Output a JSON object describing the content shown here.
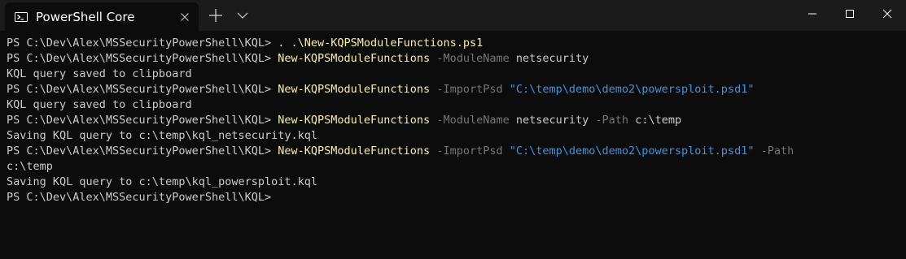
{
  "titlebar": {
    "tab_title": "PowerShell Core",
    "tab_icon": "powershell-icon",
    "new_tab_icon": "plus-icon",
    "dropdown_icon": "chevron-down-icon",
    "minimize_icon": "minimize-icon",
    "maximize_icon": "maximize-icon",
    "close_icon": "close-icon"
  },
  "colors": {
    "background": "#0c0c0c",
    "titlebar": "#1b1b1b",
    "text": "#cccccc",
    "command": "#f9f1a5",
    "parameter": "#767676",
    "string": "#3a96dd"
  },
  "terminal": {
    "lines": [
      [
        {
          "t": "PS C:\\Dev\\Alex\\MSSecurityPowerShell\\KQL> ",
          "c": "plain"
        },
        {
          "t": ". .\\New-KQPSModuleFunctions.ps1",
          "c": "cmd"
        }
      ],
      [
        {
          "t": "PS C:\\Dev\\Alex\\MSSecurityPowerShell\\KQL> ",
          "c": "plain"
        },
        {
          "t": "New-KQPSModuleFunctions",
          "c": "cmd"
        },
        {
          "t": " -ModuleName",
          "c": "param"
        },
        {
          "t": " netsecurity",
          "c": "plain"
        }
      ],
      [
        {
          "t": "KQL query saved to clipboard",
          "c": "plain"
        }
      ],
      [
        {
          "t": "PS C:\\Dev\\Alex\\MSSecurityPowerShell\\KQL> ",
          "c": "plain"
        },
        {
          "t": "New-KQPSModuleFunctions",
          "c": "cmd"
        },
        {
          "t": " -ImportPsd",
          "c": "param"
        },
        {
          "t": " \"C:\\temp\\demo\\demo2\\powersploit.psd1\"",
          "c": "str"
        }
      ],
      [
        {
          "t": "KQL query saved to clipboard",
          "c": "plain"
        }
      ],
      [
        {
          "t": "PS C:\\Dev\\Alex\\MSSecurityPowerShell\\KQL> ",
          "c": "plain"
        },
        {
          "t": "New-KQPSModuleFunctions",
          "c": "cmd"
        },
        {
          "t": " -ModuleName",
          "c": "param"
        },
        {
          "t": " netsecurity",
          "c": "plain"
        },
        {
          "t": " -Path",
          "c": "param"
        },
        {
          "t": " c:\\temp",
          "c": "plain"
        }
      ],
      [
        {
          "t": "Saving KQL query to c:\\temp\\kql_netsecurity.kql",
          "c": "plain"
        }
      ],
      [
        {
          "t": "PS C:\\Dev\\Alex\\MSSecurityPowerShell\\KQL> ",
          "c": "plain"
        },
        {
          "t": "New-KQPSModuleFunctions",
          "c": "cmd"
        },
        {
          "t": " -ImportPsd",
          "c": "param"
        },
        {
          "t": " \"C:\\temp\\demo\\demo2\\powersploit.psd1\"",
          "c": "str"
        },
        {
          "t": " -Path",
          "c": "param"
        }
      ],
      [
        {
          "t": "c:\\temp",
          "c": "plain"
        }
      ],
      [
        {
          "t": "Saving KQL query to c:\\temp\\kql_powersploit.kql",
          "c": "plain"
        }
      ],
      [
        {
          "t": "PS C:\\Dev\\Alex\\MSSecurityPowerShell\\KQL>",
          "c": "plain"
        }
      ]
    ]
  }
}
